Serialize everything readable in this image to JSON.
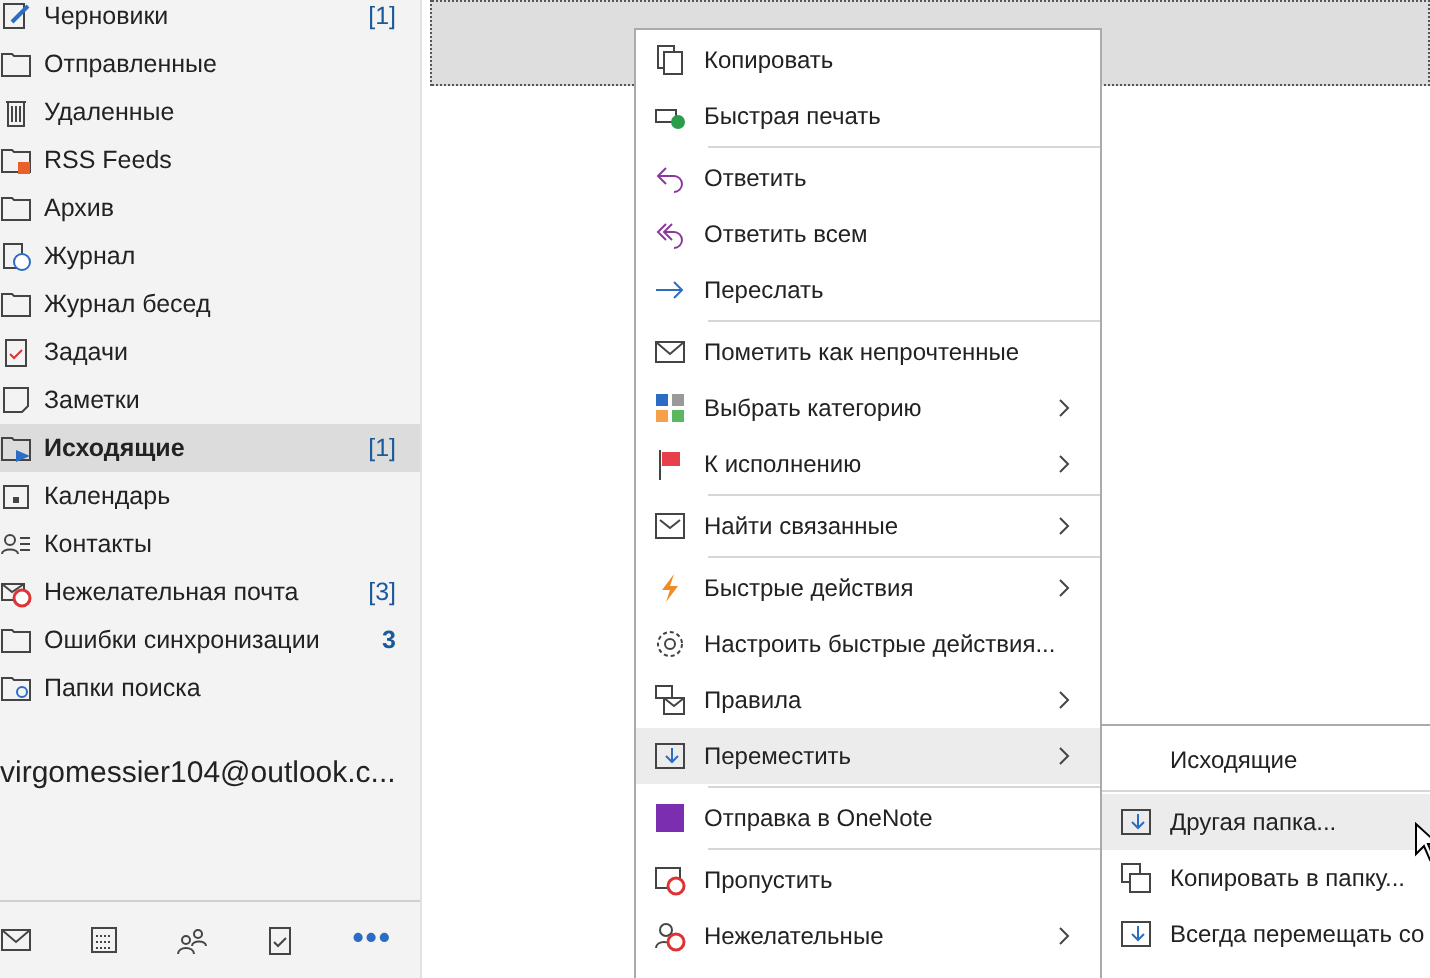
{
  "sidebar": {
    "folders": [
      {
        "label": "Черновики",
        "count": "[1]",
        "selected": false
      },
      {
        "label": "Отправленные",
        "selected": false
      },
      {
        "label": "Удаленные",
        "selected": false
      },
      {
        "label": "RSS Feeds",
        "selected": false
      },
      {
        "label": "Архив",
        "selected": false
      },
      {
        "label": "Журнал",
        "selected": false
      },
      {
        "label": "Журнал бесед",
        "selected": false
      },
      {
        "label": "Задачи",
        "selected": false
      },
      {
        "label": "Заметки",
        "selected": false
      },
      {
        "label": "Исходящие",
        "count": "[1]",
        "selected": true
      },
      {
        "label": "Календарь",
        "selected": false
      },
      {
        "label": "Контакты",
        "selected": false
      },
      {
        "label": "Нежелательная почта",
        "count": "[3]",
        "selected": false
      },
      {
        "label": "Ошибки синхронизации",
        "count": "3",
        "count_bold": true,
        "selected": false
      },
      {
        "label": "Папки поиска",
        "selected": false
      }
    ],
    "account": "virgomessier104@outlook.c...",
    "nav": [
      {
        "label": "•••",
        "selected": true
      }
    ]
  },
  "context_menu": {
    "groups": [
      [
        {
          "label": "Копировать",
          "submenu": false,
          "selected": false
        },
        {
          "label": "Быстрая печать",
          "submenu": false,
          "selected": false
        }
      ],
      [
        {
          "label": "Ответить",
          "submenu": false,
          "selected": false
        },
        {
          "label": "Ответить всем",
          "submenu": false,
          "selected": false
        },
        {
          "label": "Переслать",
          "submenu": false,
          "selected": false
        }
      ],
      [
        {
          "label": "Пометить как непрочтенные",
          "submenu": false,
          "selected": false
        },
        {
          "label": "Выбрать категорию",
          "submenu": true,
          "selected": false
        },
        {
          "label": "К исполнению",
          "submenu": true,
          "selected": false
        }
      ],
      [
        {
          "label": "Найти связанные",
          "submenu": true,
          "selected": false
        }
      ],
      [
        {
          "label": "Быстрые действия",
          "submenu": true,
          "selected": false
        },
        {
          "label": "Настроить быстрые действия...",
          "submenu": false,
          "selected": false
        },
        {
          "label": "Правила",
          "submenu": true,
          "selected": false
        },
        {
          "label": "Переместить",
          "submenu": true,
          "selected": true
        }
      ],
      [
        {
          "label": "Отправка в OneNote",
          "submenu": false,
          "selected": false
        }
      ],
      [
        {
          "label": "Пропустить",
          "submenu": false,
          "selected": false
        },
        {
          "label": "Нежелательные",
          "submenu": true,
          "selected": false
        }
      ]
    ]
  },
  "submenu": {
    "groups": [
      [
        {
          "label": "Исходящие",
          "selected": false
        }
      ],
      [
        {
          "label": "Другая папка...",
          "selected": true
        },
        {
          "label": "Копировать в папку...",
          "selected": false
        },
        {
          "label": "Всегда перемещать со",
          "selected": false
        }
      ]
    ]
  }
}
